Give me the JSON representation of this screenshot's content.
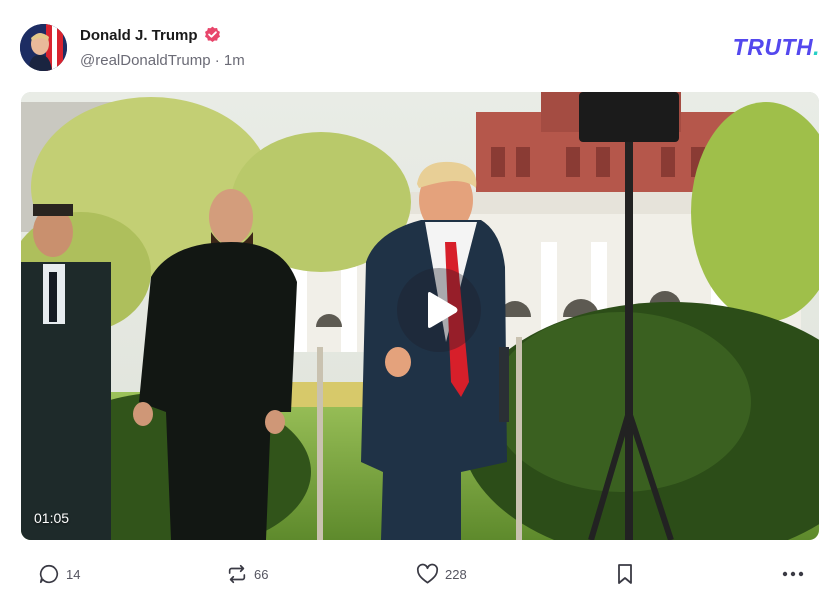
{
  "post": {
    "author_name": "Donald J. Trump",
    "handle": "@realDonaldTrump",
    "separator": "·",
    "time_ago": "1m"
  },
  "brand": {
    "word": "TRUTH",
    "dot": ".",
    "colors": {
      "word": "#5448ee",
      "dot": "#26d0c6"
    }
  },
  "media": {
    "type": "video",
    "duration": "01:05",
    "play_icon": "play-icon"
  },
  "actions": {
    "reply": {
      "icon": "reply-icon",
      "count": "14"
    },
    "retruth": {
      "icon": "retruth-icon",
      "count": "66"
    },
    "like": {
      "icon": "heart-icon",
      "count": "228"
    },
    "bookmark": {
      "icon": "bookmark-icon"
    },
    "more": {
      "icon": "more-icon"
    }
  },
  "colors": {
    "verified": "#e8466b",
    "meta_text": "#6b6b76"
  }
}
